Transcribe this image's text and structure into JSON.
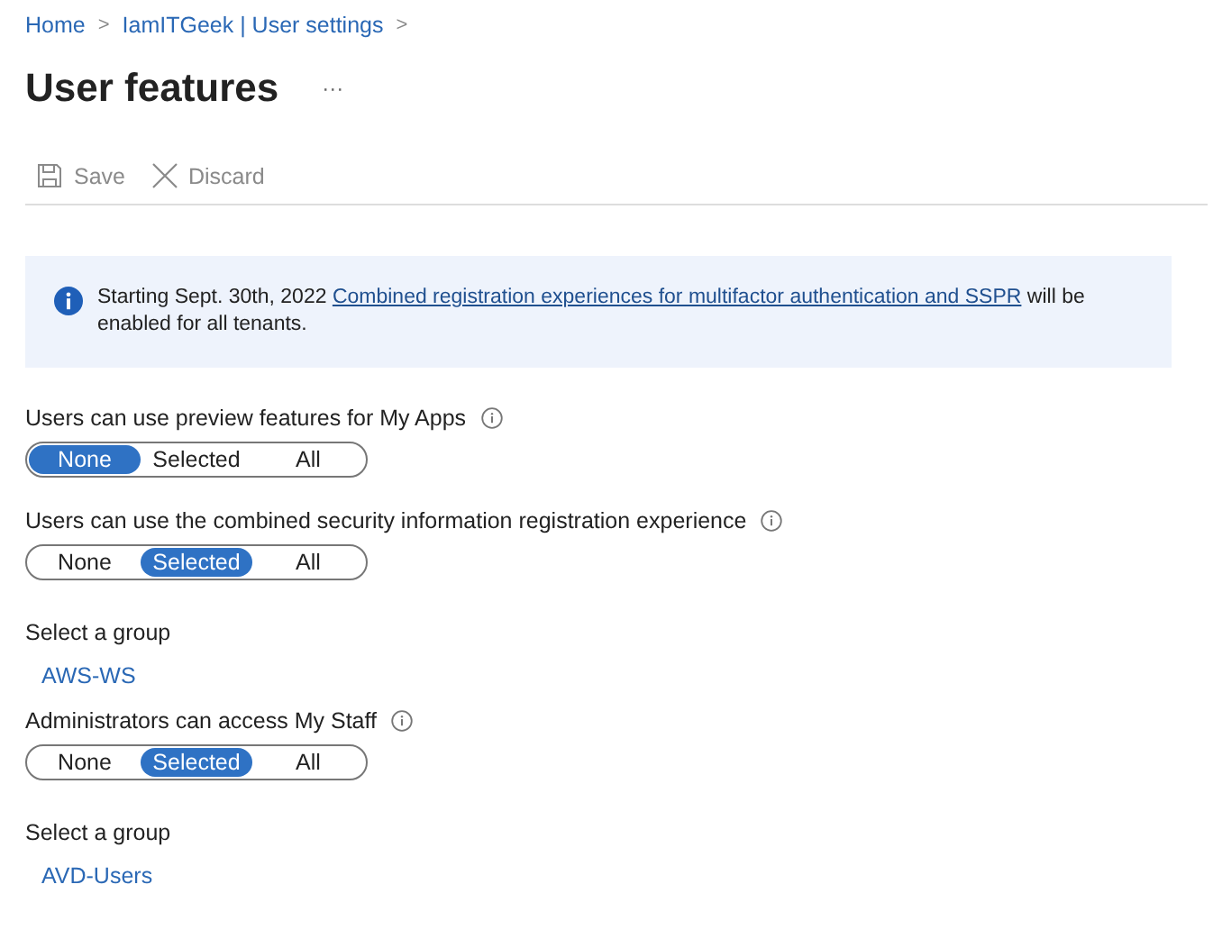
{
  "breadcrumb": [
    {
      "label": "Home"
    },
    {
      "label": "IamITGeek | User settings"
    }
  ],
  "breadcrumb_separator": ">",
  "title": "User features",
  "more": "···",
  "toolbar": [
    {
      "label": "Save",
      "kind": "save",
      "disabled": true
    },
    {
      "label": "Discard",
      "kind": "discard",
      "disabled": true
    }
  ],
  "banner": {
    "before": "Starting Sept. 30th, 2022 ",
    "link": "Combined registration experiences for multifactor authentication and SSPR",
    "after": " will be enabled for all tenants."
  },
  "settings": [
    {
      "label": "Users can use preview features for My Apps",
      "options": [
        {
          "label": "None",
          "selected": true
        },
        {
          "label": "Selected",
          "selected": false
        },
        {
          "label": "All",
          "selected": false
        }
      ]
    },
    {
      "label": "Users can use the combined security information registration experience",
      "options": [
        {
          "label": "None",
          "selected": false
        },
        {
          "label": "Selected",
          "selected": true
        },
        {
          "label": "All",
          "selected": false
        }
      ],
      "group_label": "Select a group",
      "group": "AWS-WS"
    },
    {
      "label": "Administrators can access My Staff",
      "options": [
        {
          "label": "None",
          "selected": false
        },
        {
          "label": "Selected",
          "selected": true
        },
        {
          "label": "All",
          "selected": false
        }
      ],
      "group_label": "Select a group",
      "group": "AVD-Users"
    }
  ]
}
